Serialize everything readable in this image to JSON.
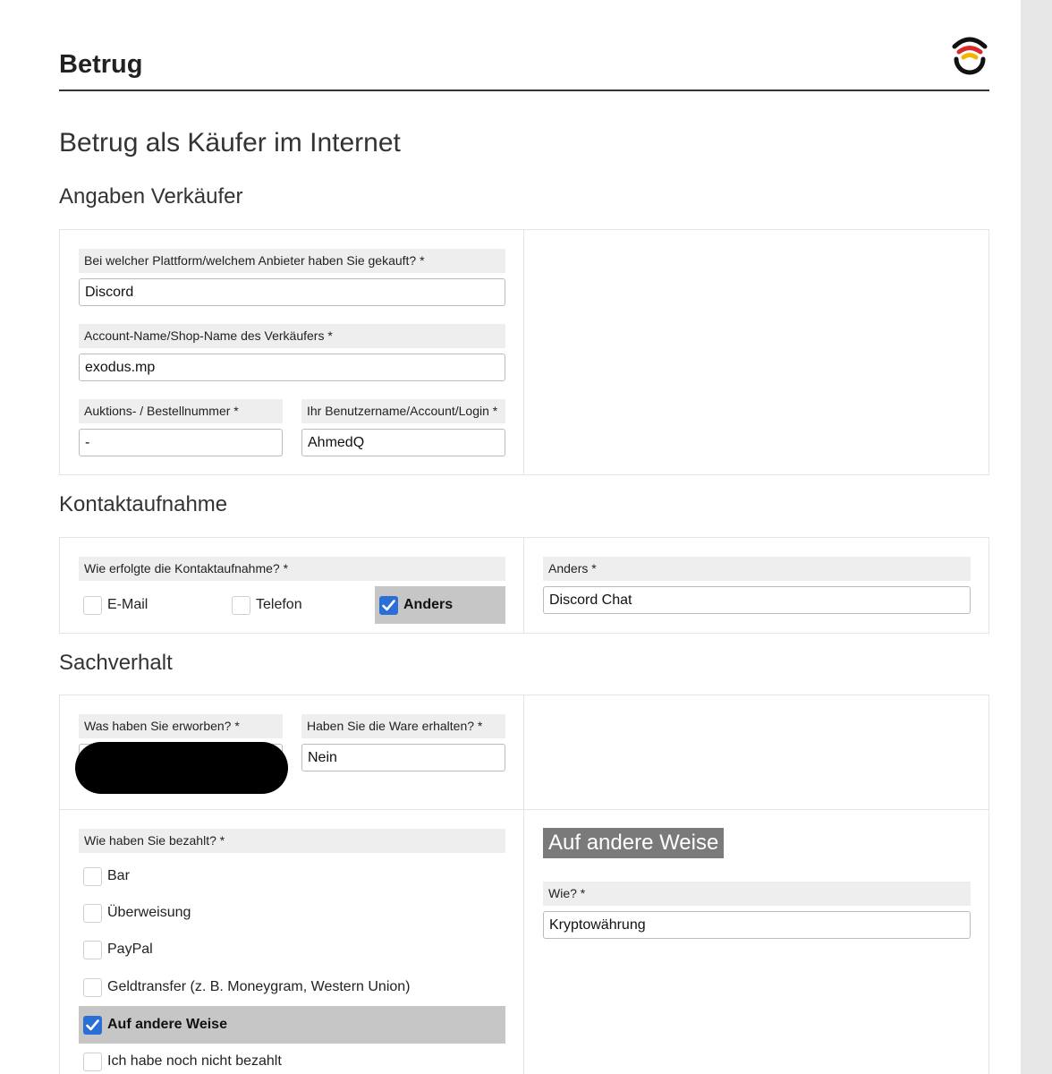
{
  "header": {
    "title": "Betrug"
  },
  "page": {
    "title": "Betrug als Käufer im Internet"
  },
  "sections": {
    "seller": "Angaben Verkäufer",
    "contact": "Kontaktaufnahme",
    "facts": "Sachverhalt"
  },
  "seller": {
    "platform_label": "Bei welcher Plattform/welchem Anbieter haben Sie gekauft? *",
    "platform_value": "Discord",
    "account_label": "Account-Name/Shop-Name des Verkäufers *",
    "account_value": "exodus.mp",
    "order_label": "Auktions- / Bestellnummer *",
    "order_value": "-",
    "login_label": "Ihr Benutzername/Account/Login *",
    "login_value": "AhmedQ"
  },
  "contact": {
    "question_label": "Wie erfolgte die Kontaktaufnahme? *",
    "options": [
      {
        "label": "E-Mail",
        "checked": false
      },
      {
        "label": "Telefon",
        "checked": false
      },
      {
        "label": "Anders",
        "checked": true
      }
    ],
    "other_label": "Anders *",
    "other_value": "Discord Chat"
  },
  "facts": {
    "acquired_label": "Was haben Sie erworben? *",
    "acquired_value": "",
    "received_label": "Haben Sie die Ware erhalten? *",
    "received_value": "Nein"
  },
  "payment": {
    "question_label": "Wie haben Sie bezahlt? *",
    "options": [
      {
        "label": "Bar",
        "checked": false
      },
      {
        "label": "Überweisung",
        "checked": false
      },
      {
        "label": "PayPal",
        "checked": false
      },
      {
        "label": "Geldtransfer (z. B. Moneygram, Western Union)",
        "checked": false
      },
      {
        "label": "Auf andere Weise",
        "checked": true
      },
      {
        "label": "Ich habe noch nicht bezahlt",
        "checked": false
      }
    ],
    "other_heading": "Auf andere Weise",
    "how_label": "Wie? *",
    "how_value": "Kryptowährung"
  },
  "colors": {
    "accent": "#2b6fd6",
    "checked_row": "#c6c6c6",
    "label_bg": "#eeeeee"
  }
}
